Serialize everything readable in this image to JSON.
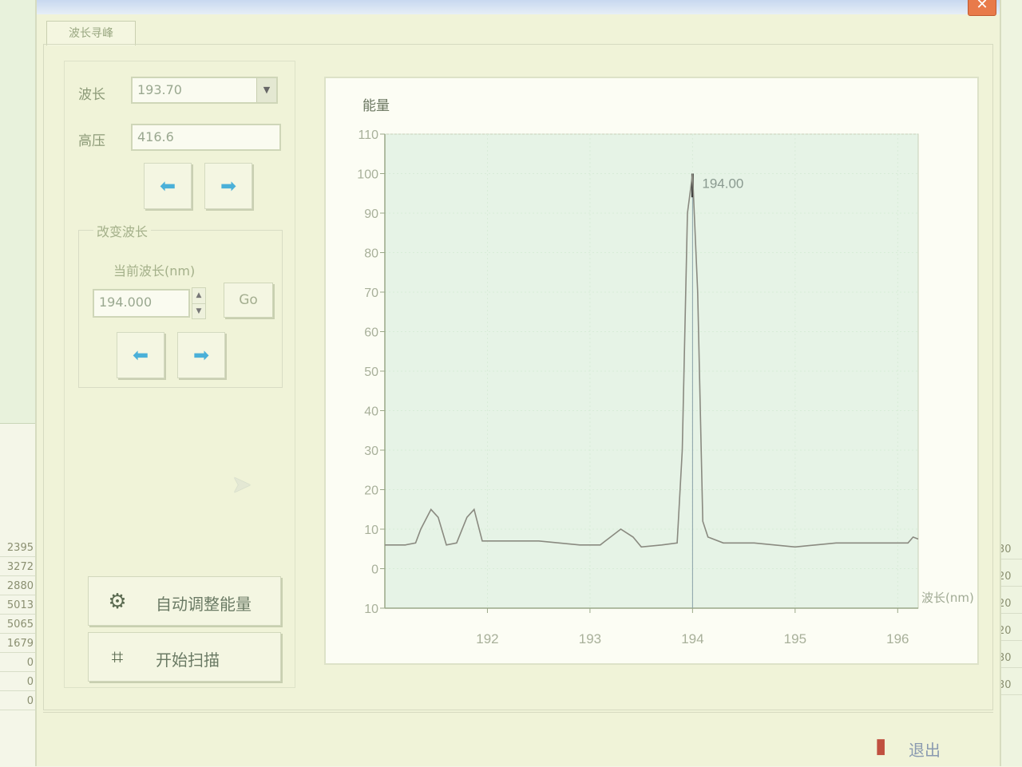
{
  "window": {
    "title": ""
  },
  "tab": {
    "label": "波长寻峰"
  },
  "controls": {
    "wavelength_label": "波长",
    "wavelength_value": "193.70",
    "voltage_label": "高压",
    "voltage_value": "416.6",
    "change_group_title": "改变波长",
    "current_label": "当前波长(nm)",
    "current_value": "194.000",
    "go_label": "Go",
    "auto_adjust_label": "自动调整能量",
    "start_scan_label": "开始扫描",
    "exit_label": "退出"
  },
  "icons": {
    "left_arrow": "left-arrow-icon",
    "right_arrow": "right-arrow-icon",
    "spin_up": "spin-up-icon",
    "spin_down": "spin-down-icon",
    "combo_down": "chevron-down-icon",
    "auto_adjust": "energy-adjust-icon",
    "scan": "scan-icon",
    "exit": "exit-icon",
    "close": "close-icon"
  },
  "colors": {
    "plot_bg": "#e6f3e6",
    "curve": "#8a8a80",
    "peak_line": "#333333",
    "accent_arrow": "#4ab0d8"
  },
  "background_numbers_left": [
    "2395",
    "3272",
    "2880",
    "5013",
    "5065",
    "1679",
    "0",
    "0",
    "0"
  ],
  "background_numbers_right": [
    "30",
    "20",
    "20",
    "20",
    "30",
    "30"
  ],
  "chart_data": {
    "type": "line",
    "ylabel": "能量",
    "xlabel": "波长(nm)",
    "ylim": [
      -10,
      110
    ],
    "xlim": [
      191.0,
      196.2
    ],
    "yticks": [
      "110",
      "100",
      "90",
      "80",
      "70",
      "60",
      "50",
      "40",
      "30",
      "20",
      "10",
      "0",
      "10"
    ],
    "yticks_values": [
      110,
      100,
      90,
      80,
      70,
      60,
      50,
      40,
      30,
      20,
      10,
      0,
      -10
    ],
    "xticks": [
      "192",
      "193",
      "194",
      "195",
      "196"
    ],
    "xticks_values": [
      192,
      193,
      194,
      195,
      196
    ],
    "marker": {
      "x": 194.0,
      "label": "194.00"
    },
    "grid": true,
    "series": [
      {
        "x": [
          191.0,
          191.2,
          191.3,
          191.35,
          191.45,
          191.52,
          191.6,
          191.7,
          191.8,
          191.87,
          191.95,
          192.05,
          192.5,
          192.9,
          193.1,
          193.15,
          193.3,
          193.42,
          193.5,
          193.7,
          193.85,
          193.9,
          193.95,
          194.0,
          194.05,
          194.1,
          194.15,
          194.3,
          194.6,
          195.0,
          195.4,
          195.8,
          196.1,
          196.15,
          196.2
        ],
        "y": [
          6,
          6,
          6.5,
          10,
          15,
          13,
          6,
          6.5,
          13,
          15,
          7,
          7,
          7,
          6,
          6,
          7,
          10,
          8,
          5.5,
          6,
          6.5,
          30,
          90,
          100,
          70,
          12,
          8,
          6.5,
          6.5,
          5.5,
          6.5,
          6.5,
          6.5,
          8,
          7.5
        ]
      }
    ]
  }
}
